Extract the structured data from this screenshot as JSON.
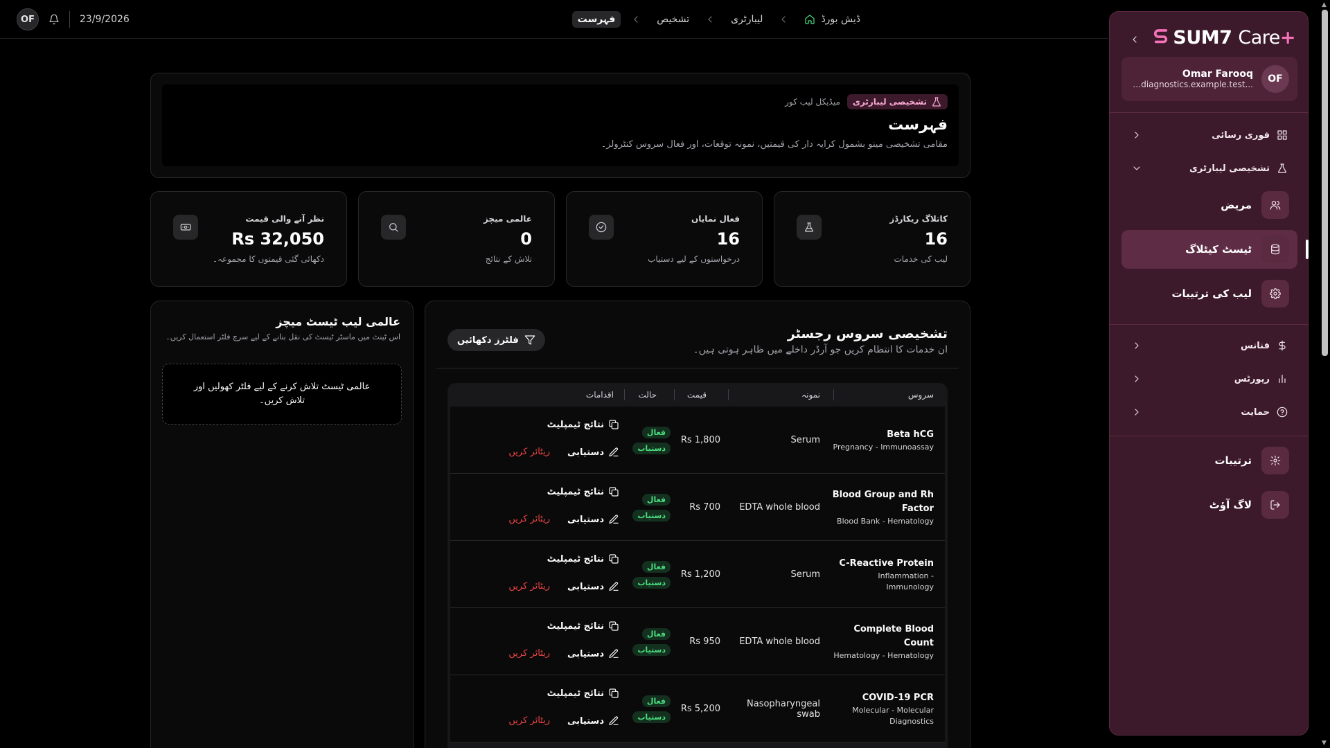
{
  "topbar": {
    "avatar_initials": "OF",
    "date": "23/9/2026",
    "breadcrumb": [
      "ڈیش بورڈ",
      "لیبارٹری",
      "تشخیص",
      "فہرست"
    ]
  },
  "sidebar": {
    "logo_brand": "SUM7",
    "logo_care": "Care",
    "logo_plus": "+",
    "user": {
      "initials": "OF",
      "name": "Omar Farooq",
      "email": "...arpath-diagnostics.example.test"
    },
    "groups": {
      "quick_access": "فوری رسائی",
      "diagnostics_lab": "تشخیصی لیبارٹری",
      "finance": "فنانس",
      "reports": "رپورٹس",
      "support": "حمایت"
    },
    "items": {
      "patient": "مریض",
      "test_catalog": "ٹیسٹ کیٹلاگ",
      "lab_settings": "لیب کی ترتیبات",
      "settings": "ترتیبات",
      "logout": "لاگ آؤٹ"
    }
  },
  "header": {
    "badge": "تشخیصی لیبارٹری",
    "subtitle": "میڈیکل لیب کور",
    "title": "فہرست",
    "description": "مقامی تشخیصی مینو بشمول کرایہ دار کی قیمتیں، نمونہ توقعات، اور فعال سروس کنٹرولز۔"
  },
  "stats": [
    {
      "label": "کاتلاگ ریکارڈز",
      "value": "16",
      "note": "لیب کی خدمات",
      "icon": "flask-icon"
    },
    {
      "label": "فعال نمایاں",
      "value": "16",
      "note": "درخواستوں کے لیے دستیاب",
      "icon": "check-circle-icon"
    },
    {
      "label": "عالمی میچز",
      "value": "0",
      "note": "تلاش کے نتائج",
      "icon": "search-icon"
    },
    {
      "label": "نظر آنے والی قیمت",
      "value": "Rs 32,050",
      "note": "دکھائی گئی قیمتوں کا مجموعہ۔",
      "icon": "banknote-icon"
    }
  ],
  "registry": {
    "title": "تشخیصی سروس رجسٹر",
    "subtitle": "ان خدمات کا انتظام کریں جو آرڈر داخلے میں ظاہر ہوتی ہیں۔",
    "filter_label": "فلٹرز دکھائیں",
    "columns": {
      "service": "سروس",
      "sample": "نمونہ",
      "price": "قیمت",
      "status": "حالت",
      "actions": "اقدامات"
    },
    "action_labels": {
      "template": "نتائج ٹیمپلیٹ",
      "availability": "دستیابی",
      "retire": "ریٹائر کریں"
    },
    "status_labels": {
      "active": "فعال",
      "available": "دستیاب"
    },
    "rows": [
      {
        "name": "Beta hCG",
        "category": "Pregnancy - Immunoassay",
        "sample": "Serum",
        "price": "Rs 1,800"
      },
      {
        "name": "Blood Group and Rh Factor",
        "category": "Blood Bank - Hematology",
        "sample": "EDTA whole blood",
        "price": "Rs 700"
      },
      {
        "name": "C-Reactive Protein",
        "category": "Inflammation - Immunology",
        "sample": "Serum",
        "price": "Rs 1,200"
      },
      {
        "name": "Complete Blood Count",
        "category": "Hematology - Hematology",
        "sample": "EDTA whole blood",
        "price": "Rs 950"
      },
      {
        "name": "COVID-19 PCR",
        "category": "Molecular - Molecular Diagnostics",
        "sample": "Nasopharyngeal swab",
        "price": "Rs 5,200"
      }
    ]
  },
  "global": {
    "title": "عالمی لیب ٹیسٹ میچز",
    "description": "اس ٹینٹ میں ماسٹر ٹیسٹ کی نقل بنانے کے لیے سرچ فلٹر استعمال کریں۔",
    "empty_state": "عالمی ٹیسٹ تلاش کرنے کے لیے فلٹر کھولیں اور تلاش کریں۔"
  }
}
